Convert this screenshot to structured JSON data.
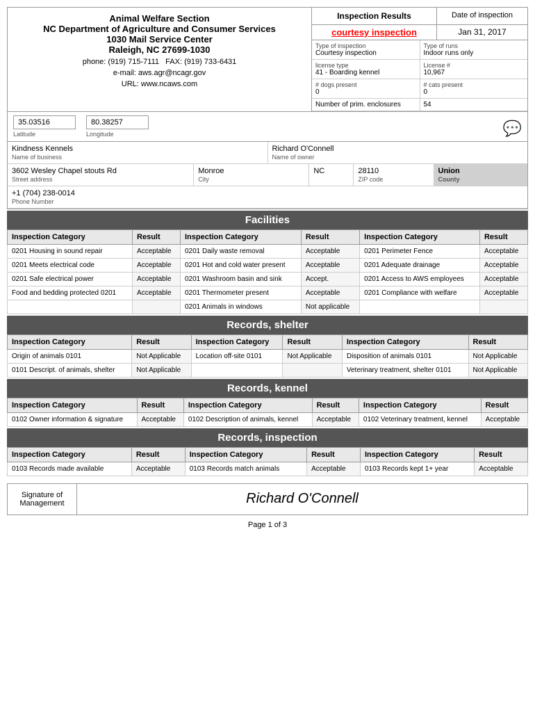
{
  "header": {
    "org_line1": "Animal Welfare Section",
    "org_line2": "NC Department of Agriculture and Consumer Services",
    "org_line3": "1030 Mail Service Center",
    "org_line4": "Raleigh, NC 27699-1030",
    "phone": "phone: (919) 715-7111",
    "fax": "FAX: (919) 733-6431",
    "email": "e-mail: aws.agr@ncagr.gov",
    "url": "URL: www.ncaws.com"
  },
  "inspection_results": {
    "label": "Inspection Results",
    "courtesy_label": "courtesy inspection",
    "date_of_inspection_label": "Date of inspection",
    "date_value": "Jan 31, 2017"
  },
  "type_of_inspection": {
    "label": "Type of inspection",
    "value": "Courtesy inspection"
  },
  "type_of_runs": {
    "label": "Type of runs",
    "value": "Indoor runs only"
  },
  "license_type": {
    "label": "license type",
    "value": "41 - Boarding kennel"
  },
  "license_num": {
    "label": "License #",
    "value": "10,967"
  },
  "dogs_present": {
    "label": "# dogs present",
    "value": "0"
  },
  "cats_present": {
    "label": "# cats present",
    "value": "0"
  },
  "prim_enclosures": {
    "label": "Number of prim. enclosures",
    "value": "54"
  },
  "latitude": {
    "value": "35.03516",
    "label": "Latitude"
  },
  "longitude": {
    "value": "80.38257",
    "label": "Longitude"
  },
  "business": {
    "name": "Kindness Kennels",
    "name_label": "Name of business",
    "owner": "Richard O'Connell",
    "owner_label": "Name of owner",
    "street": "3602 Wesley Chapel stouts Rd",
    "street_label": "Street address",
    "city": "Monroe",
    "city_label": "City",
    "state": "NC",
    "zip": "28110",
    "zip_label": "ZIP code",
    "county": "Union",
    "county_label": "County",
    "phone": "+1 (704) 238-0014",
    "phone_label": "Phone Number"
  },
  "facilities": {
    "section_title": "Facilities",
    "headers": [
      "Inspection Category",
      "Result",
      "Inspection Category",
      "Result",
      "Inspection Category",
      "Result"
    ],
    "rows": [
      [
        "0201 Housing in sound repair",
        "Acceptable",
        "0201 Daily waste removal",
        "Acceptable",
        "0201 Perimeter Fence",
        "Acceptable"
      ],
      [
        "0201 Meets electrical code",
        "Acceptable",
        "0201 Hot and cold water present",
        "Acceptable",
        "0201 Adequate drainage",
        "Acceptable"
      ],
      [
        "0201 Safe electrical power",
        "Acceptable",
        "0201 Washroom basin and sink",
        "Accept.",
        "0201 Access to AWS employees",
        "Acceptable"
      ],
      [
        "Food and bedding protected 0201",
        "Acceptable",
        "0201 Thermometer present",
        "Acceptable",
        "0201 Compliance with welfare",
        "Acceptable"
      ],
      [
        "",
        "",
        "0201 Animals in windows",
        "Not applicable",
        "",
        ""
      ]
    ]
  },
  "records_shelter": {
    "section_title": "Records, shelter",
    "headers": [
      "Inspection Category",
      "Result",
      "Inspection Category",
      "Result",
      "Inspection Category",
      "Result"
    ],
    "rows": [
      [
        "Origin of animals 0101",
        "Not Applicable",
        "Location off-site 0101",
        "Not Applicable",
        "Disposition of animals 0101",
        "Not Applicable"
      ],
      [
        "0101 Descript. of animals, shelter",
        "Not Applicable",
        "",
        "",
        "Veterinary treatment, shelter 0101",
        "Not Applicable"
      ]
    ]
  },
  "records_kennel": {
    "section_title": "Records, kennel",
    "headers": [
      "Inspection Category",
      "Result",
      "Inspection Category",
      "Result",
      "Inspection Category",
      "Result"
    ],
    "rows": [
      [
        "0102 Owner information & signature",
        "Acceptable",
        "0102 Description of animals, kennel",
        "Acceptable",
        "0102 Veterinary treatment, kennel",
        "Acceptable"
      ]
    ]
  },
  "records_inspection": {
    "section_title": "Records, inspection",
    "headers": [
      "Inspection Category",
      "Result",
      "Inspection Category",
      "Result",
      "Inspection Category",
      "Result"
    ],
    "rows": [
      [
        "0103 Records made available",
        "Acceptable",
        "0103 Records match animals",
        "Acceptable",
        "0103 Records kept 1+ year",
        "Acceptable"
      ]
    ]
  },
  "signature": {
    "label": "Signature of Management",
    "value": "Richard O'Connell"
  },
  "footer": {
    "page": "Page 1 of 3"
  }
}
